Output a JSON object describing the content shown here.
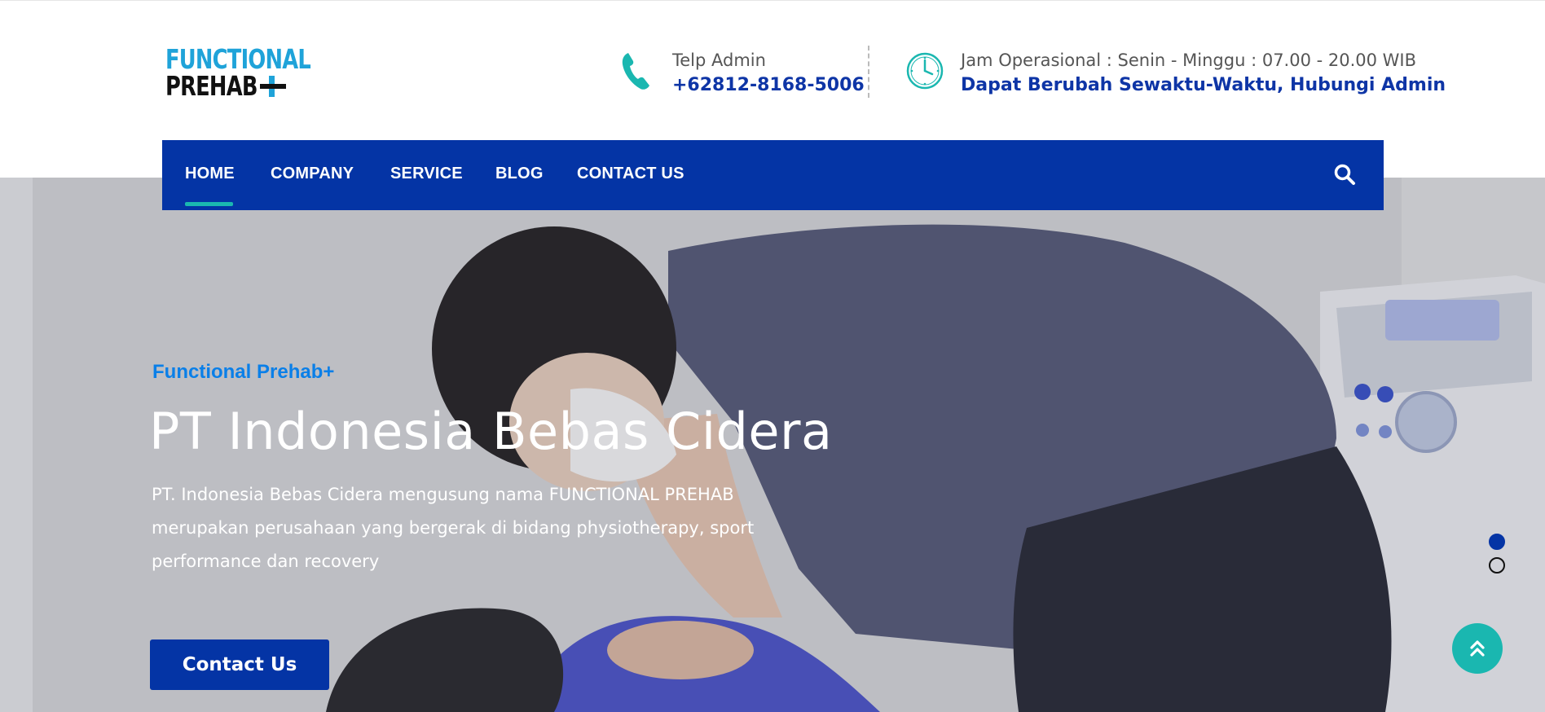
{
  "logo": {
    "line1": "FUNCTIONAL",
    "line2": "PREHAB"
  },
  "contact": {
    "label": "Telp Admin",
    "phone": "+62812-8168-5006"
  },
  "hours": {
    "label": "Jam Operasional : Senin - Minggu : 07.00 - 20.00 WIB",
    "note": "Dapat Berubah Sewaktu-Waktu, Hubungi Admin"
  },
  "nav": {
    "items": [
      {
        "label": "HOME",
        "active": true
      },
      {
        "label": "COMPANY",
        "active": false
      },
      {
        "label": "SERVICE",
        "active": false
      },
      {
        "label": "BLOG",
        "active": false
      },
      {
        "label": "CONTACT US",
        "active": false
      }
    ]
  },
  "hero": {
    "subtitle": "Functional Prehab+",
    "title": "PT Indonesia Bebas Cidera",
    "description": "PT. Indonesia Bebas Cidera mengusung nama FUNCTIONAL PREHAB merupakan perusahaan yang bergerak di bidang physiotherapy, sport performance dan recovery",
    "button_label": "Contact Us"
  },
  "slider": {
    "slides": 2,
    "active": 1
  },
  "colors": {
    "brand_blue": "#0434a5",
    "accent_teal": "#1ab7b0",
    "logo_cyan": "#1fa3d9",
    "subtitle_blue": "#0a7fe8"
  },
  "icons": {
    "phone": "phone-icon",
    "clock": "clock-icon",
    "search": "search-icon",
    "scroll_top": "double-chevron-up-icon"
  }
}
